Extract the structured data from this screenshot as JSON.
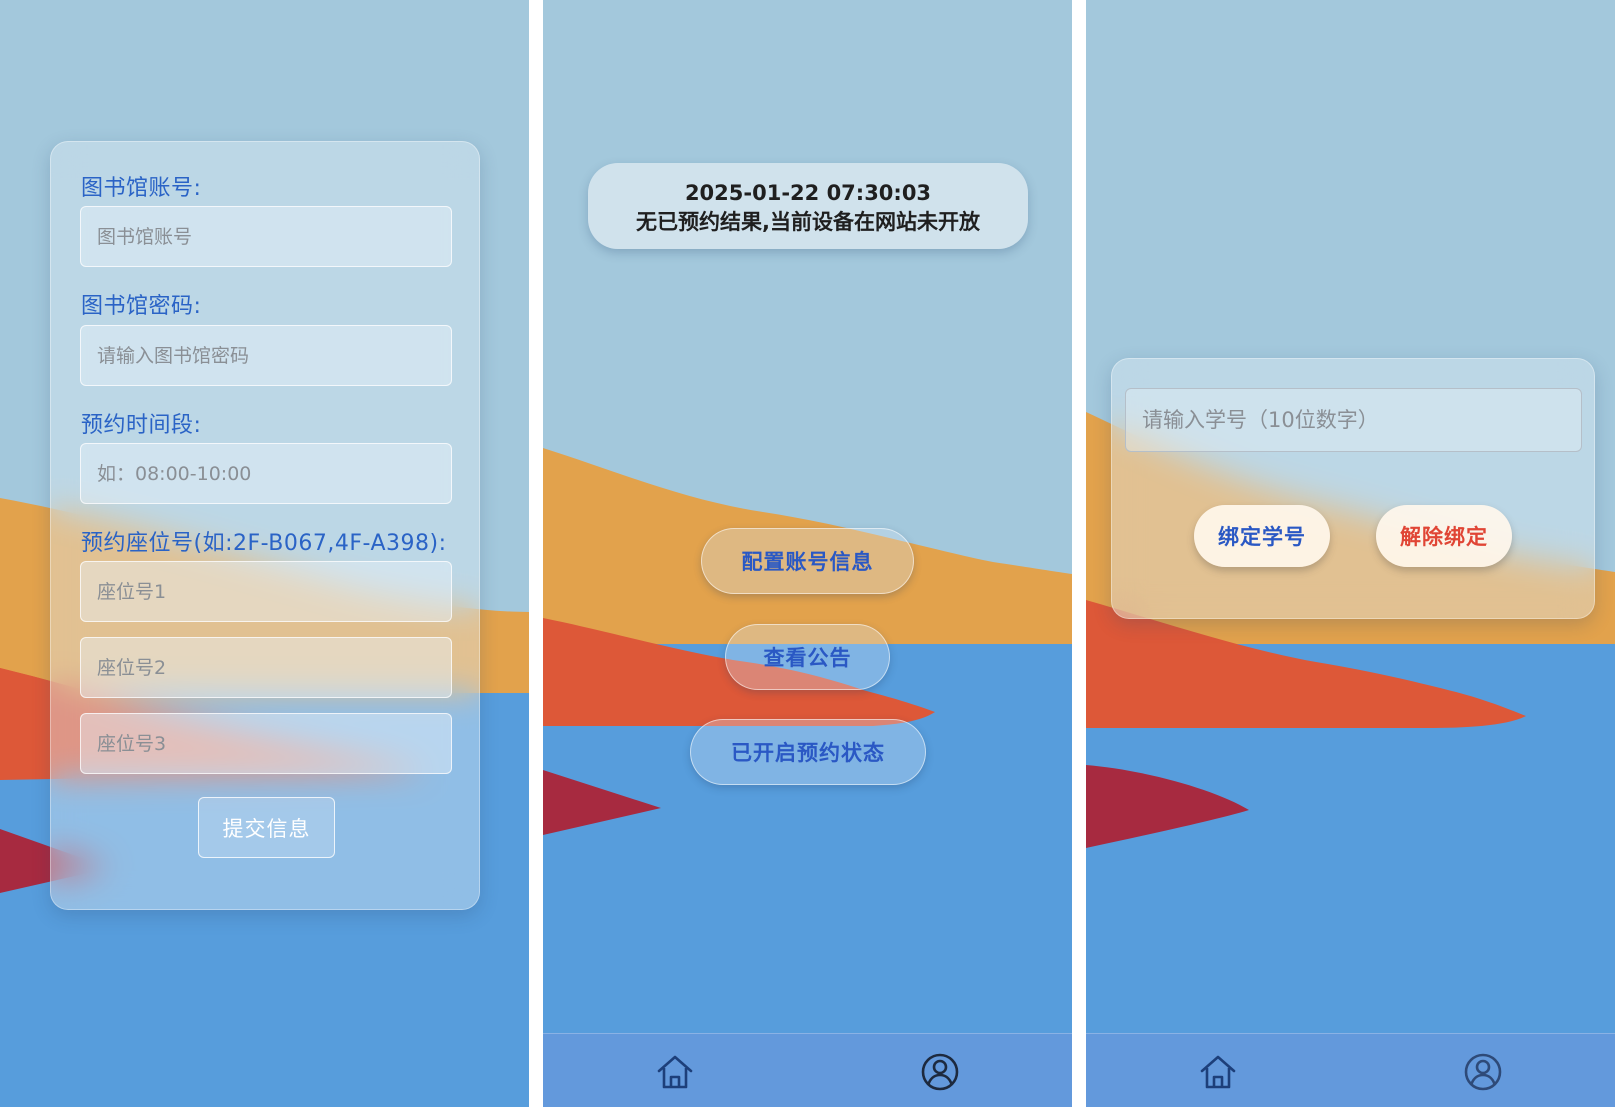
{
  "form": {
    "account_label": "图书馆账号:",
    "account_placeholder": "图书馆账号",
    "password_label": "图书馆密码:",
    "password_placeholder": "请输入图书馆密码",
    "time_label": "预约时间段:",
    "time_placeholder": "如：08:00-10:00",
    "seat_label": "预约座位号(如:2F-B067,4F-A398):",
    "seat1_placeholder": "座位号1",
    "seat2_placeholder": "座位号2",
    "seat3_placeholder": "座位号3",
    "submit_label": "提交信息"
  },
  "home": {
    "status_datetime": "2025-01-22 07:30:03",
    "status_message": "无已预约结果,当前设备在网站未开放",
    "config_button": "配置账号信息",
    "notice_button": "查看公告",
    "reservation_status_button": "已开启预约状态"
  },
  "bind": {
    "student_id_placeholder": "请输入学号（10位数字）",
    "bind_button": "绑定学号",
    "unbind_button": "解除绑定"
  },
  "tabbar": {
    "home_icon": "home-icon",
    "user_icon": "user-icon"
  },
  "colors": {
    "sky": "#a3c8dc",
    "sand": "#e2a24c",
    "rock": "#dd5838",
    "dark_rock": "#a72a40",
    "sea": "#579ddc",
    "accent_blue": "#2a58c4",
    "accent_red": "#e04535",
    "tabbar": "#6399dc"
  }
}
